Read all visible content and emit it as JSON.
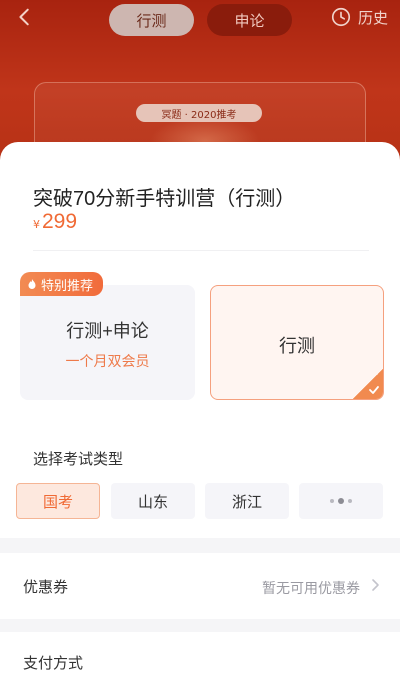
{
  "header": {
    "tabs": [
      {
        "label": "行测",
        "active": true
      },
      {
        "label": "申论",
        "active": false
      }
    ],
    "history_label": "历史",
    "promo_badge": "冥题 · 2020推考"
  },
  "product": {
    "title": "突破70分新手特训营（行测）",
    "currency": "¥",
    "price": "299"
  },
  "options": {
    "recommend_tag": "特别推荐",
    "left": {
      "name": "行测+申论",
      "sub": "一个月双会员"
    },
    "right": {
      "name": "行测",
      "selected": true
    }
  },
  "exam_type": {
    "label": "选择考试类型",
    "chips": [
      "国考",
      "山东",
      "浙江"
    ],
    "selected": "国考"
  },
  "coupon": {
    "label": "优惠券",
    "value": "暂无可用优惠券"
  },
  "payment": {
    "label": "支付方式"
  },
  "colors": {
    "accent": "#f06a35",
    "header_bg": "#b23013"
  }
}
